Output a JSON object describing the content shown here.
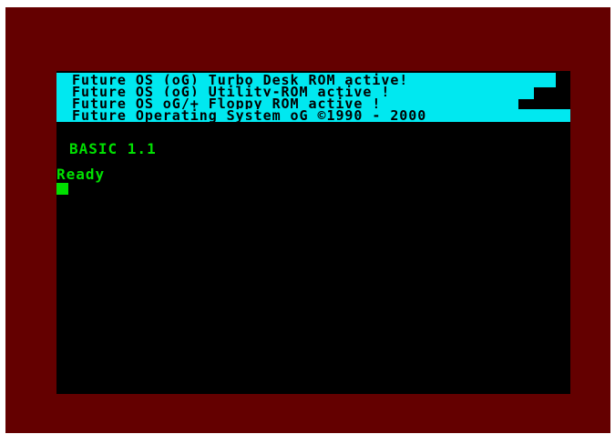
{
  "screen": {
    "rom_messages": [
      "Future OS (oG) Turbo Desk ROM active!",
      "Future OS (oG) Utility-ROM active !",
      "Future OS oG/+ Floppy ROM active !",
      "Future Operating System oG ©1990 - 2000"
    ],
    "basic_version": "BASIC 1.1",
    "prompt": "Ready"
  },
  "colors": {
    "border": "#640000",
    "paper": "#000000",
    "rom_banner_background": "#00e8f0",
    "rom_banner_text": "#000000",
    "basic_text": "#00e000"
  }
}
